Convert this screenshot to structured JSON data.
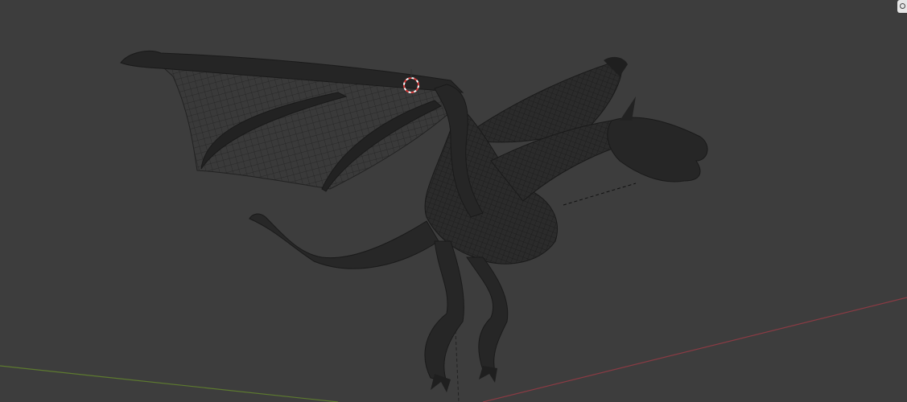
{
  "viewport": {
    "mode": "3D viewport",
    "object": "dragon-mesh",
    "shading": "wireframe-overlay",
    "colors": {
      "background": "#3d3d3d",
      "x_axis": "#8a3b44",
      "y_axis": "#5d7a2f",
      "mesh": "#2a2a2a",
      "wire": "#1a1a1a",
      "cursor_red": "#d43c3c",
      "cursor_white": "#ffffff"
    }
  },
  "icons": {
    "gizmo": "navigation-gizmo-icon",
    "cursor": "3d-cursor-icon"
  }
}
